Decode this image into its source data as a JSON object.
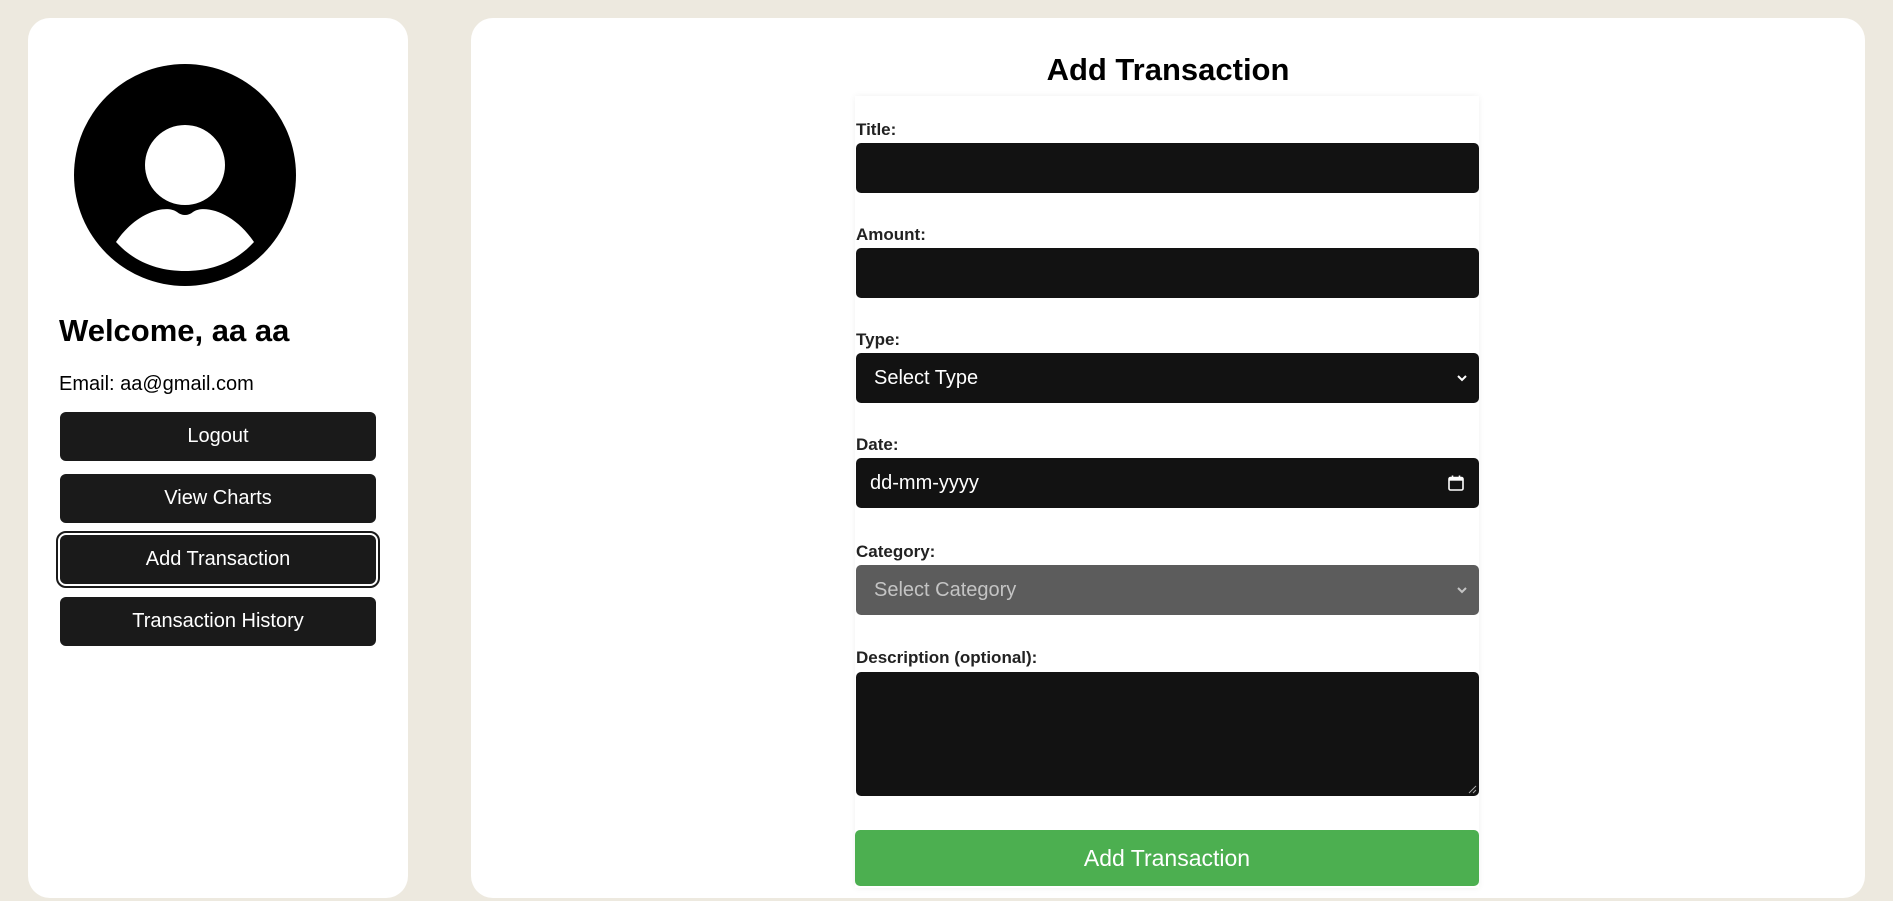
{
  "sidebar": {
    "welcome": "Welcome, aa aa",
    "email": "Email: aa@gmail.com",
    "buttons": [
      {
        "label": "Logout"
      },
      {
        "label": "View Charts"
      },
      {
        "label": "Add Transaction"
      },
      {
        "label": "Transaction History"
      }
    ],
    "active_button": "Add Transaction"
  },
  "main": {
    "title": "Add Transaction",
    "form": {
      "title_label": "Title:",
      "title_value": "",
      "amount_label": "Amount:",
      "amount_value": "",
      "type_label": "Type:",
      "type_selected": "Select Type",
      "date_label": "Date:",
      "date_placeholder": "dd-mm-yyyy",
      "category_label": "Category:",
      "category_selected": "Select Category",
      "category_disabled": true,
      "description_label": "Description (optional):",
      "description_value": "",
      "submit_label": "Add Transaction"
    }
  },
  "icons": {
    "avatar": "user-avatar-icon",
    "type_chevron": "chevron-down-icon",
    "category_chevron": "chevron-down-icon",
    "date_picker": "calendar-icon",
    "resize": "resize-grip-icon"
  },
  "colors": {
    "background": "#ede9df",
    "panel": "#ffffff",
    "button_dark": "#1a1a1a",
    "field_dark": "#121212",
    "disabled_field": "#5c5c5c",
    "submit_green": "#4caf50"
  }
}
